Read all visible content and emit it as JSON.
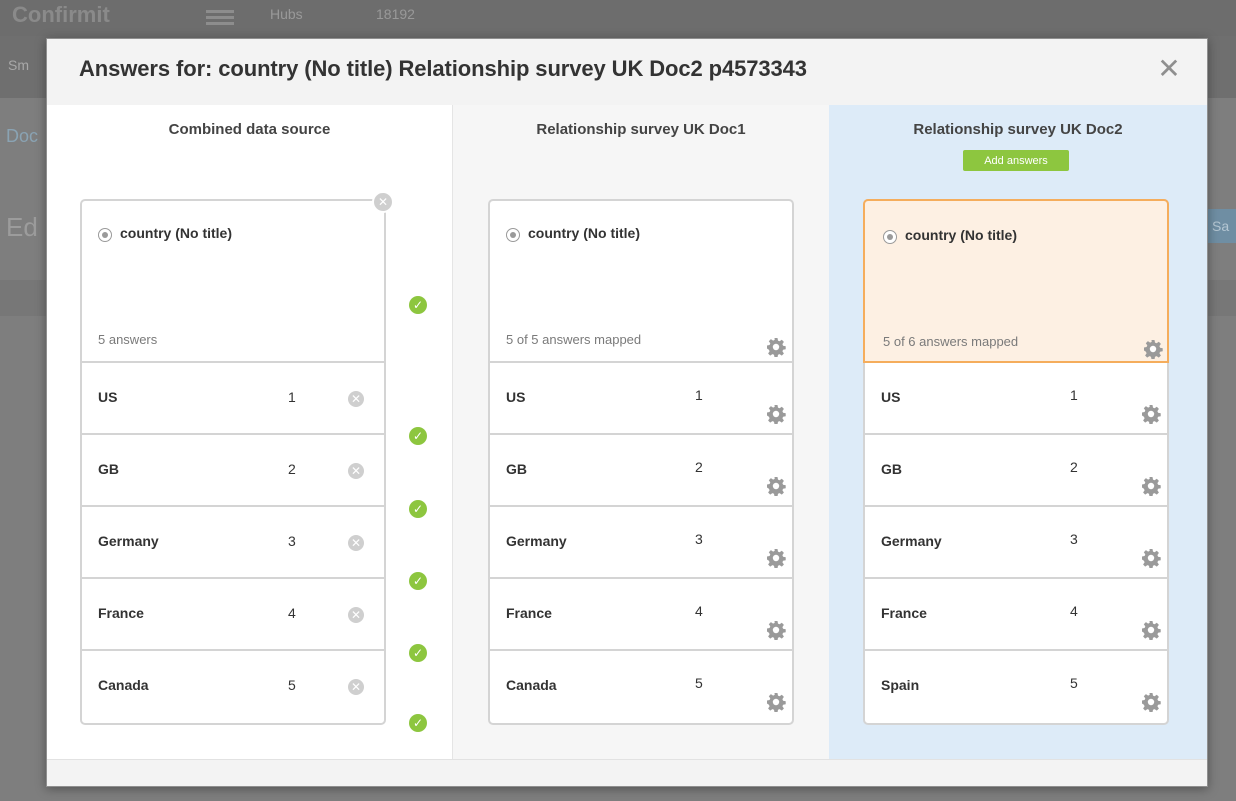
{
  "background": {
    "brand": "Confirmit",
    "hubs": "Hubs",
    "crumb": "18192",
    "subtext": "Sm",
    "doc_link": "Doc",
    "page_title": "Ed",
    "save_button": "Sa"
  },
  "modal": {
    "title": "Answers for: country (No title) Relationship survey UK Doc2 p4573343",
    "close_label": "✕"
  },
  "columns": [
    {
      "heading": "Combined data source",
      "question": "country (No title)",
      "answer_count": "5 answers",
      "answers": [
        {
          "label": "US",
          "code": "1"
        },
        {
          "label": "GB",
          "code": "2"
        },
        {
          "label": "Germany",
          "code": "3"
        },
        {
          "label": "France",
          "code": "4"
        },
        {
          "label": "Canada",
          "code": "5"
        }
      ]
    },
    {
      "heading": "Relationship survey UK Doc1",
      "question": "country (No title)",
      "answer_count": "5 of 5 answers mapped",
      "answers": [
        {
          "label": "US",
          "code": "1"
        },
        {
          "label": "GB",
          "code": "2"
        },
        {
          "label": "Germany",
          "code": "3"
        },
        {
          "label": "France",
          "code": "4"
        },
        {
          "label": "Canada",
          "code": "5"
        }
      ]
    },
    {
      "heading": "Relationship survey UK Doc2",
      "add_answers_label": "Add answers",
      "question": "country (No title)",
      "answer_count": "5 of 6 answers mapped",
      "answers": [
        {
          "label": "US",
          "code": "1"
        },
        {
          "label": "GB",
          "code": "2"
        },
        {
          "label": "Germany",
          "code": "3"
        },
        {
          "label": "France",
          "code": "4"
        },
        {
          "label": "Spain",
          "code": "5"
        }
      ]
    }
  ],
  "icons": {
    "remove": "remove-icon",
    "check": "check-icon",
    "gear": "gear-icon",
    "radio": "radio-icon"
  },
  "colors": {
    "accent_green": "#8dc63f",
    "selected_border": "#f5ad5c",
    "selected_bg": "#fdf0e3",
    "active_column_bg": "#ddebf8"
  }
}
